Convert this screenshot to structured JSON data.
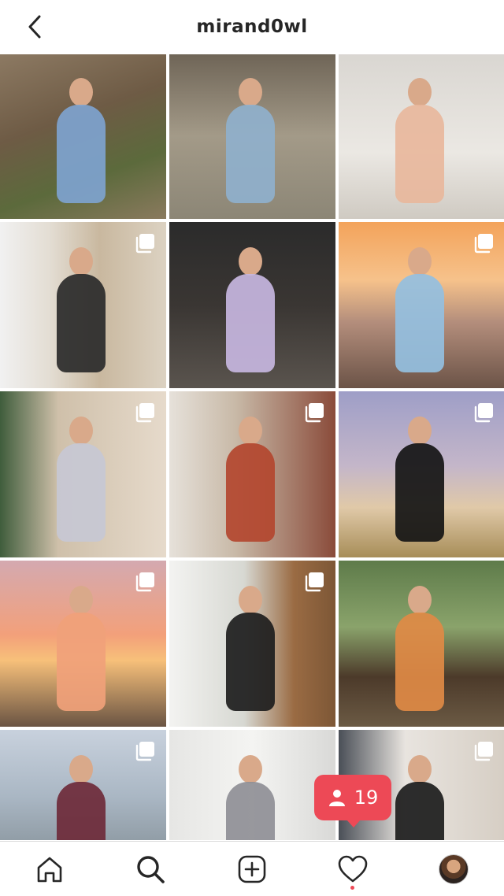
{
  "header": {
    "username": "mirand0wl"
  },
  "grid": {
    "tiles": [
      {
        "id": 1,
        "bg": "linear-gradient(160deg,#8d7a63 0%,#6e5b45 40%,#5c6a3c 70%,#8a7a5e 100%)",
        "figure": "#7ea3cf",
        "multi": false
      },
      {
        "id": 2,
        "bg": "linear-gradient(180deg,#6e6456 0%,#a39a88 50%,#8c8676 100%)",
        "figure": "#8fb0cc",
        "multi": false
      },
      {
        "id": 3,
        "bg": "linear-gradient(180deg,#d9d6d1 0%,#ebe8e3 60%,#cfcac2 100%)",
        "figure": "#e8b79c",
        "multi": false
      },
      {
        "id": 4,
        "bg": "linear-gradient(90deg,#f1f1f1 0%,#e3ddd3 30%,#c9b89f 60%,#dcd2c2 100%)",
        "figure": "#2a2a2a",
        "multi": true
      },
      {
        "id": 5,
        "bg": "linear-gradient(180deg,#2b2b2b 0%,#3a3633 50%,#5a544e 100%)",
        "figure": "#c7b6e0",
        "multi": false
      },
      {
        "id": 6,
        "bg": "linear-gradient(180deg,#f3a35b 0%,#f6c28b 35%,#b48e7c 60%,#6b5347 100%)",
        "figure": "#94bfe0",
        "multi": true
      },
      {
        "id": 7,
        "bg": "linear-gradient(90deg,#3f5d3c 0%,#cfc0aa 35%,#e6dacb 100%)",
        "figure": "#c7c8d4",
        "multi": true
      },
      {
        "id": 8,
        "bg": "linear-gradient(90deg,#e6e1da 0%,#c8b9a7 40%,#8a4b3a 100%)",
        "figure": "#b3462f",
        "multi": true
      },
      {
        "id": 9,
        "bg": "linear-gradient(180deg,#9e9ec7 0%,#c4b6c9 45%,#e0c9a8 70%,#a78d58 100%)",
        "figure": "#151515",
        "multi": true
      },
      {
        "id": 10,
        "bg": "linear-gradient(180deg,#d4a9b0 0%,#f3a07a 45%,#f7c07a 60%,#6a5443 100%)",
        "figure": "#f0a17a",
        "multi": true
      },
      {
        "id": 11,
        "bg": "linear-gradient(90deg,#f3f3f1 0%,#d7d8d2 45%,#9a6b43 75%,#7d5736 100%)",
        "figure": "#1d1d1d",
        "multi": true
      },
      {
        "id": 12,
        "bg": "linear-gradient(180deg,#5e7b4a 0%,#8aa36b 40%,#4c3a2a 70%,#6b5a44 100%)",
        "figure": "#e08a45",
        "multi": false
      },
      {
        "id": 13,
        "bg": "linear-gradient(180deg,#c8d1dd 0%,#aab7c4 40%,#8e9aa3 70%,#a9a9a4 100%)",
        "figure": "#6e2a3a",
        "multi": true
      },
      {
        "id": 14,
        "bg": "linear-gradient(90deg,#e6e6e4 0%,#f4f4f2 50%,#d9d9d7 100%)",
        "figure": "#8f8f96",
        "multi": false
      },
      {
        "id": 15,
        "bg": "linear-gradient(90deg,#4a4f57 0%,#e8e4df 40%,#d6cec4 100%)",
        "figure": "#1c1c1c",
        "multi": true
      }
    ]
  },
  "notification": {
    "count": "19",
    "icon": "person-icon"
  },
  "nav": {
    "items": [
      "home-icon",
      "search-icon",
      "new-post-icon",
      "activity-heart-icon",
      "profile-avatar"
    ],
    "accent": "#ed4956"
  }
}
